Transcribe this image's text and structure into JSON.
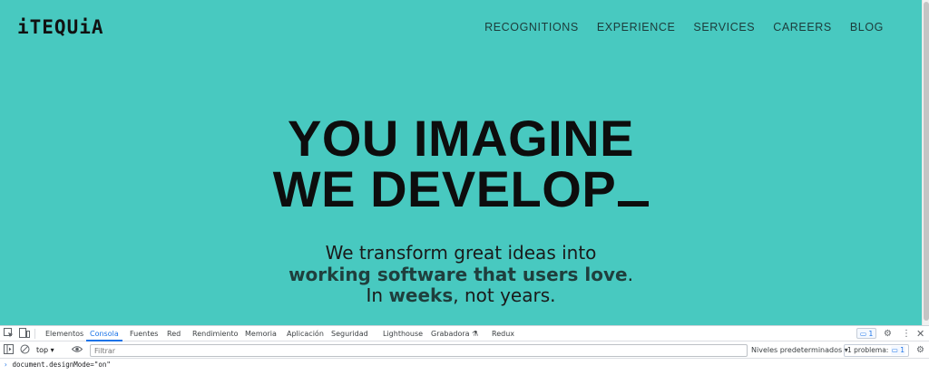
{
  "site": {
    "logo": "iTEQUiA",
    "nav": [
      "RECOGNITIONS",
      "EXPERIENCE",
      "SERVICES",
      "CAREERS",
      "BLOG"
    ],
    "hero": {
      "title_line1": "YOU IMAGINE",
      "title_line2": "WE DEVELOP",
      "sub_line1": "We transform great ideas into",
      "sub_line2_bold": "working software that users love",
      "sub_line2_end": ".",
      "sub_line3_start": "In ",
      "sub_line3_bold": "weeks",
      "sub_line3_end": ", not years."
    },
    "colors": {
      "background": "#48c9c0",
      "text": "#0d0d0d",
      "accent_bold": "#1f3f3d"
    }
  },
  "devtools": {
    "tabs": [
      "Elementos",
      "Consola",
      "Fuentes",
      "Red",
      "Rendimiento",
      "Memoria",
      "Aplicación",
      "Seguridad",
      "Lighthouse",
      "Grabadora",
      "Redux"
    ],
    "active_tab": "Consola",
    "issues_badge": "1",
    "context": "top",
    "filter_placeholder": "Filtrar",
    "levels": "Niveles predeterminados",
    "problems_label": "1 problema:",
    "problems_count": "1",
    "console_prompt": "›",
    "console_input": "document.designMode=\"on\""
  }
}
